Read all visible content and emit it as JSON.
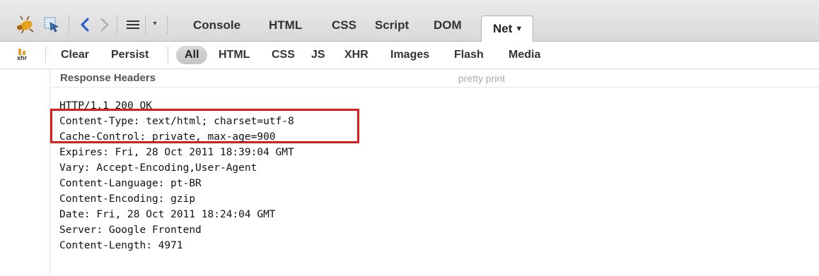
{
  "toolbar": {
    "tabs": [
      {
        "label": "Console"
      },
      {
        "label": "HTML"
      },
      {
        "label": "CSS"
      },
      {
        "label": "Script"
      },
      {
        "label": "DOM"
      }
    ],
    "active_tab": {
      "label": "Net",
      "caret": "▼"
    }
  },
  "filters": {
    "clear": "Clear",
    "persist": "Persist",
    "items": [
      "All",
      "HTML",
      "CSS",
      "JS",
      "XHR",
      "Images",
      "Flash",
      "Media"
    ],
    "xhr_icon_label": "xhr"
  },
  "response": {
    "title": "Response Headers",
    "pretty_print": "pretty print",
    "lines": [
      "HTTP/1.1 200 OK",
      "Content-Type: text/html; charset=utf-8",
      "Cache-Control: private, max-age=900",
      "Expires: Fri, 28 Oct 2011 18:39:04 GMT",
      "Vary: Accept-Encoding,User-Agent",
      "Content-Language: pt-BR",
      "Content-Encoding: gzip",
      "Date: Fri, 28 Oct 2011 18:24:04 GMT",
      "Server: Google Frontend",
      "Content-Length: 4971"
    ]
  },
  "colors": {
    "highlight": "#e01b1b",
    "firebug_bug": "#e6a21e"
  }
}
